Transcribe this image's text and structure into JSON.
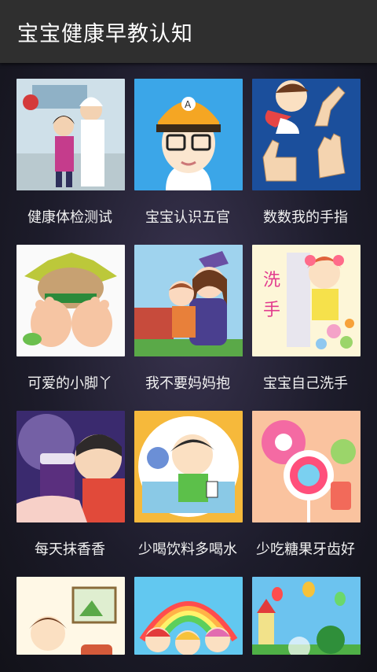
{
  "appbar": {
    "title": "宝宝健康早教认知"
  },
  "items": [
    {
      "label": "健康体检测试",
      "icon": "doctor-checkup-icon"
    },
    {
      "label": "宝宝认识五官",
      "icon": "boy-face-icon"
    },
    {
      "label": "数数我的手指",
      "icon": "counting-fingers-icon"
    },
    {
      "label": "可爱的小脚丫",
      "icon": "baby-feet-icon"
    },
    {
      "label": "我不要妈妈抱",
      "icon": "mother-child-icon"
    },
    {
      "label": "宝宝自己洗手",
      "icon": "wash-hands-icon"
    },
    {
      "label": "每天抹香香",
      "icon": "face-cream-icon"
    },
    {
      "label": "少喝饮料多喝水",
      "icon": "drink-water-icon"
    },
    {
      "label": "少吃糖果牙齿好",
      "icon": "candy-lollipop-icon"
    },
    {
      "label": "",
      "icon": "eating-girl-icon"
    },
    {
      "label": "",
      "icon": "rainbow-kids-icon"
    },
    {
      "label": "",
      "icon": "castle-balloons-icon"
    }
  ]
}
